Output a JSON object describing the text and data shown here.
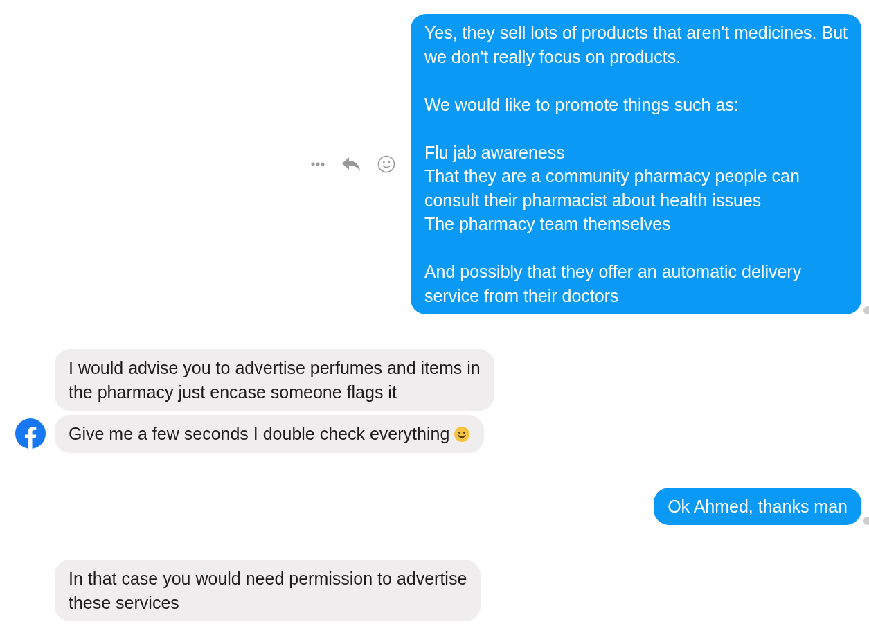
{
  "messages": [
    {
      "kind": "sent",
      "text": "Yes, they sell lots of products that aren't medicines. But\nwe don't really focus on products.\n\nWe would like to promote things such as:\n\nFlu jab awareness\nThat they are a community pharmacy people can\nconsult their pharmacist about health issues\nThe pharmacy team themselves\n\nAnd possibly that they offer an automatic delivery\nservice from their doctors",
      "show_actions": true,
      "seen": true
    },
    {
      "kind": "received",
      "text": "I would advise you to advertise perfumes and items in\nthe pharmacy just encase someone flags it",
      "show_actions": false,
      "seen": false
    },
    {
      "kind": "received",
      "text": "Give me a few seconds I double check everything",
      "emoji": true,
      "avatar": true,
      "show_actions": false,
      "seen": false
    },
    {
      "kind": "sent",
      "text": "Ok Ahmed, thanks man",
      "show_actions": false,
      "seen": true
    },
    {
      "kind": "received",
      "text": "In that case you would need permission to advertise\nthese services",
      "show_actions": false,
      "seen": false
    }
  ]
}
